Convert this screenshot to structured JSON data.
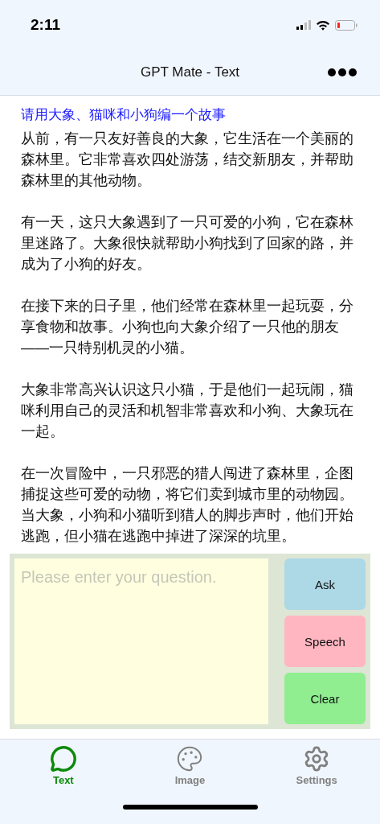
{
  "status_bar": {
    "time": "2:11"
  },
  "nav": {
    "title": "GPT Mate - Text"
  },
  "question": "请用大象、猫咪和小狗编一个故事",
  "answer": [
    "从前，有一只友好善良的大象，它生活在一个美丽的森林里。它非常喜欢四处游荡，结交新朋友，并帮助森林里的其他动物。",
    "有一天，这只大象遇到了一只可爱的小狗，它在森林里迷路了。大象很快就帮助小狗找到了回家的路，并成为了小狗的好友。",
    "在接下来的日子里，他们经常在森林里一起玩耍，分享食物和故事。小狗也向大象介绍了一只他的朋友——一只特别机灵的小猫。",
    "大象非常高兴认识这只小猫，于是他们一起玩闹，猫咪利用自己的灵活和机智非常喜欢和小狗、大象玩在一起。",
    "在一次冒险中，一只邪恶的猎人闯进了森林里，企图捕捉这些可爱的动物，将它们卖到城市里的动物园。当大象，小狗和小猫听到猎人的脚步声时，他们开始逃跑，但小猫在逃跑中掉进了深深的坑里。"
  ],
  "input": {
    "placeholder": "Please enter your question."
  },
  "buttons": [
    {
      "label": "Ask",
      "color": "#add8e6"
    },
    {
      "label": "Speech",
      "color": "#ffb6c1"
    },
    {
      "label": "Clear",
      "color": "#90ee90"
    }
  ],
  "tabs": [
    {
      "label": "Text",
      "kind": "chat",
      "selected": true
    },
    {
      "label": "Image",
      "kind": "palette",
      "selected": false
    },
    {
      "label": "Settings",
      "kind": "gear",
      "selected": false
    }
  ]
}
